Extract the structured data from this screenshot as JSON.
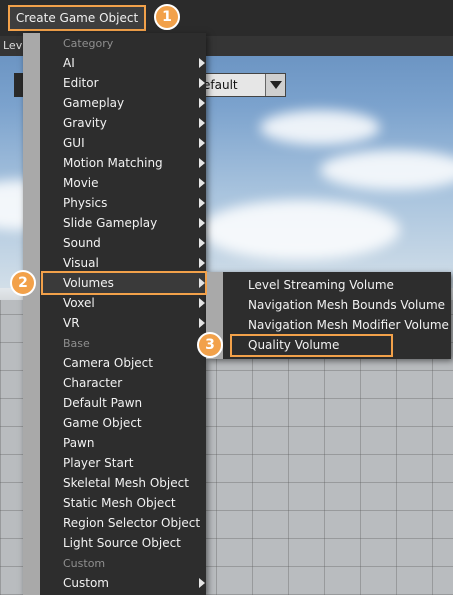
{
  "toolbar": {
    "create_label": "Create Game Object"
  },
  "level_tab": {
    "label": "Lev"
  },
  "dropdown": {
    "value": "efault"
  },
  "main_menu": {
    "categories": {
      "category": "Category",
      "base": "Base",
      "custom": "Custom"
    },
    "items": [
      {
        "label": "AI",
        "submenu": true
      },
      {
        "label": "Editor",
        "submenu": true
      },
      {
        "label": "Gameplay",
        "submenu": true
      },
      {
        "label": "Gravity",
        "submenu": true
      },
      {
        "label": "GUI",
        "submenu": true
      },
      {
        "label": "Motion Matching",
        "submenu": true
      },
      {
        "label": "Movie",
        "submenu": true
      },
      {
        "label": "Physics",
        "submenu": true
      },
      {
        "label": "Slide Gameplay",
        "submenu": true
      },
      {
        "label": "Sound",
        "submenu": true
      },
      {
        "label": "Visual",
        "submenu": true
      },
      {
        "label": "Volumes",
        "submenu": true
      },
      {
        "label": "Voxel",
        "submenu": true
      },
      {
        "label": "VR",
        "submenu": true
      }
    ],
    "base_items": [
      "Camera Object",
      "Character",
      "Default Pawn",
      "Game Object",
      "Pawn",
      "Player Start",
      "Skeletal Mesh Object",
      "Static Mesh Object",
      "Region Selector Object",
      "Light Source Object"
    ],
    "custom_items": [
      {
        "label": "Custom",
        "submenu": true
      }
    ]
  },
  "sub_menu": {
    "items": [
      "Level Streaming Volume",
      "Navigation Mesh Bounds Volume",
      "Navigation Mesh Modifier Volume",
      "Quality Volume"
    ]
  },
  "badges": [
    "1",
    "2",
    "3"
  ],
  "colors": {
    "accent": "#f2a14a",
    "menu_bg": "#2d2d2d",
    "gutter": "#a9a9a9"
  }
}
